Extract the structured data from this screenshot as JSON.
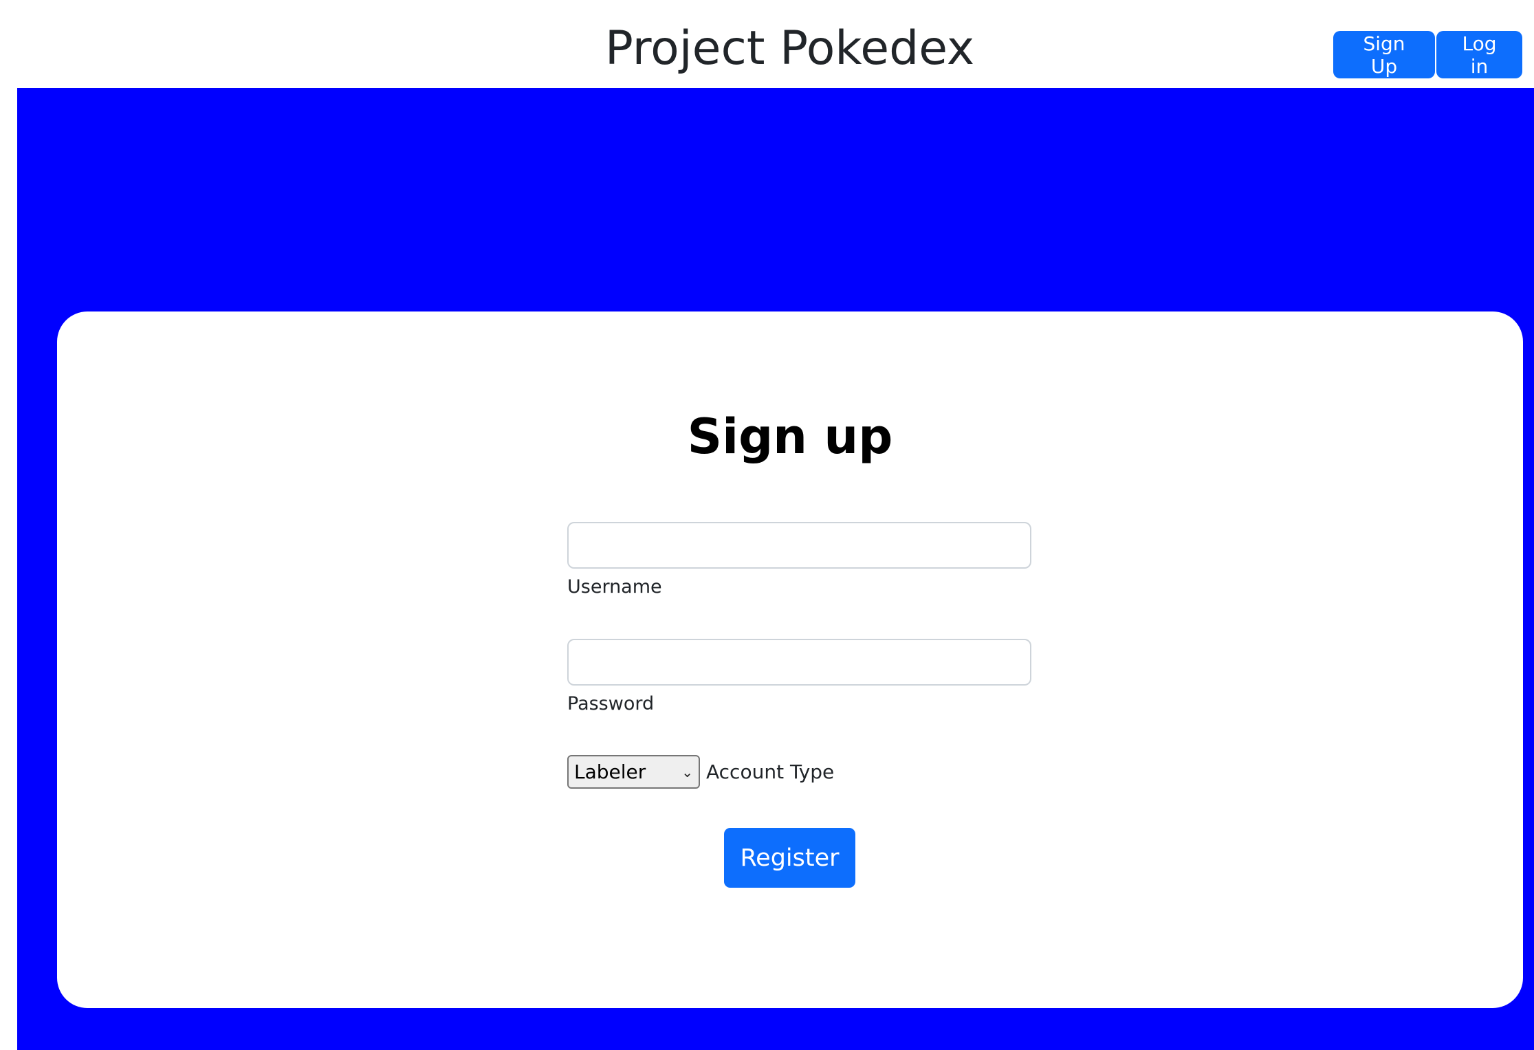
{
  "header": {
    "title": "Project Pokedex",
    "signup_label": "Sign Up",
    "login_label": "Log in"
  },
  "form": {
    "title": "Sign up",
    "username": {
      "label": "Username",
      "value": ""
    },
    "password": {
      "label": "Password",
      "value": ""
    },
    "account_type": {
      "selected": "Labeler",
      "label": "Account Type",
      "icon": "chevron-down-icon"
    },
    "register_label": "Register"
  },
  "colors": {
    "primary": "#0d6efd",
    "background_band": "#0000ff",
    "card": "#ffffff"
  }
}
